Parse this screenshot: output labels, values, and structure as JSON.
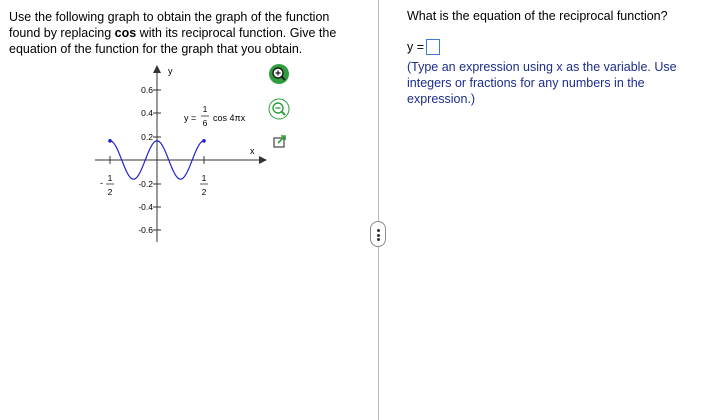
{
  "question": {
    "part1": "Use the following graph to obtain the graph of the function found by replacing ",
    "bold": "cos",
    "part2": " with its reciprocal function. Give the equation of the function for the graph that you obtain."
  },
  "graph": {
    "y_axis_label": "y",
    "x_axis_label": "x",
    "y_ticks": [
      "0.6",
      "0.4",
      "0.2",
      "-0.2",
      "-0.4",
      "-0.6"
    ],
    "x_tick_left": {
      "num": "1",
      "den": "2",
      "sign": "-"
    },
    "x_tick_right": {
      "num": "1",
      "den": "2"
    },
    "equation": {
      "prefix": "y =",
      "num": "1",
      "den": "6",
      "suffix": "cos 4πx"
    },
    "curve": {
      "amplitude": 0.16667,
      "period": 0.5,
      "x_range": [
        -0.5,
        0.5
      ],
      "color": "#2222cc"
    }
  },
  "tools": [
    {
      "name": "zoom-in-icon",
      "color": "#2e9e3e"
    },
    {
      "name": "zoom-out-icon",
      "color": "#2e9e3e"
    },
    {
      "name": "popout-icon",
      "color": "#2e9e3e"
    }
  ],
  "answer": {
    "question": "What is the equation of the reciprocal function?",
    "label": "y =",
    "value": "",
    "hint": "(Type an expression using x as the variable. Use integers or fractions for any numbers in the expression.)"
  }
}
